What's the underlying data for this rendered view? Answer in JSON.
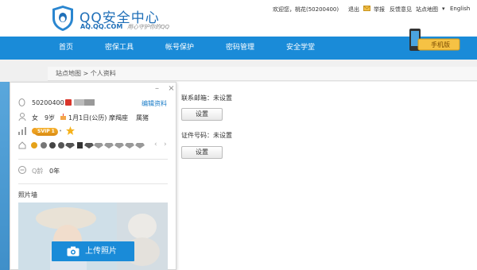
{
  "logo": {
    "title": "QQ安全中心",
    "domain": "AQ.QQ.COM",
    "slogan": "用心守护你的QQ"
  },
  "topbar": {
    "welcome": "欢迎您，桃花(50200400)",
    "logout": "退出",
    "report": "举报",
    "feedback": "反馈意见",
    "sitemap": "站点地图",
    "english": "English"
  },
  "nav": {
    "items": [
      "首页",
      "密保工具",
      "帐号保护",
      "密码管理",
      "安全学堂"
    ]
  },
  "phone_badge": "手机版",
  "breadcrumb": "站点地图 > 个人资料",
  "profile": {
    "qq_number": "50200400",
    "edit_label": "编辑资料",
    "gender": "女",
    "age": "9岁",
    "birthday": "1月1日(公历)",
    "zodiac": "摩羯座",
    "chinese_zodiac": "属猪",
    "svip": "SVIP 1",
    "q_age_label": "Q龄",
    "q_age_value": "0年",
    "photo_wall_label": "照片墙",
    "upload_label": "上传照片",
    "window_min": "–",
    "window_close": "×"
  },
  "content": {
    "email_label": "联系邮箱：未设置",
    "email_btn": "设置",
    "id_label": "证件号码：未设置",
    "id_btn": "设置"
  },
  "colors": {
    "nav_bg": "#1a8bd8",
    "logo_blue": "#1f6fb8",
    "link_blue": "#1a7cc8"
  }
}
